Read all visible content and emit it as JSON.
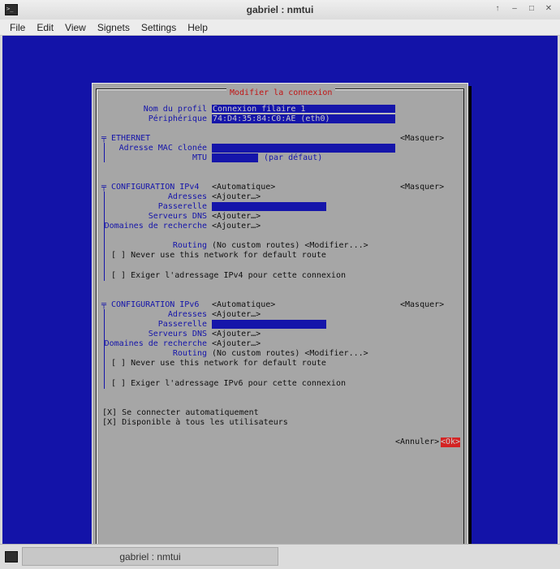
{
  "window": {
    "title": "gabriel : nmtui"
  },
  "menu": [
    "File",
    "Edit",
    "View",
    "Signets",
    "Settings",
    "Help"
  ],
  "dialog": {
    "title": "Modifier la connexion",
    "profile_label": "Nom du profil",
    "profile_value": "Connexion filaire 1",
    "device_label": "Périphérique",
    "device_value": "74:D4:35:84:C0:AE (eth0)",
    "ethernet": {
      "heading": "ETHERNET",
      "hide": "<Masquer>",
      "mac_label": "Adresse MAC clonée",
      "mtu_label": "MTU",
      "mtu_default": "(par défaut)"
    },
    "ipv4": {
      "heading": "CONFIGURATION IPv4",
      "mode": "<Automatique>",
      "hide": "<Masquer>",
      "addresses_label": "Adresses",
      "addresses_btn": "<Ajouter…>",
      "gateway_label": "Passerelle",
      "dns_label": "Serveurs DNS",
      "dns_btn": "<Ajouter…>",
      "search_label": "Domaines de recherche",
      "search_btn": "<Ajouter…>",
      "routing_label": "Routing",
      "routing_value": "(No custom routes) <Modifier...>",
      "never_default": "[ ] Never use this network for default route",
      "require": "[ ] Exiger l'adressage IPv4 pour cette connexion"
    },
    "ipv6": {
      "heading": "CONFIGURATION IPv6",
      "mode": "<Automatique>",
      "hide": "<Masquer>",
      "addresses_label": "Adresses",
      "addresses_btn": "<Ajouter…>",
      "gateway_label": "Passerelle",
      "dns_label": "Serveurs DNS",
      "dns_btn": "<Ajouter…>",
      "search_label": "Domaines de recherche",
      "search_btn": "<Ajouter…>",
      "routing_label": "Routing",
      "routing_value": "(No custom routes) <Modifier...>",
      "never_default": "[ ] Never use this network for default route",
      "require": "[ ] Exiger l'adressage IPv6 pour cette connexion"
    },
    "auto_connect": "[X] Se connecter automatiquement",
    "all_users": "[X] Disponible à tous les utilisateurs",
    "cancel": "<Annuler>",
    "ok": "<Ok>"
  },
  "taskbar": {
    "task_label": "gabriel : nmtui"
  }
}
